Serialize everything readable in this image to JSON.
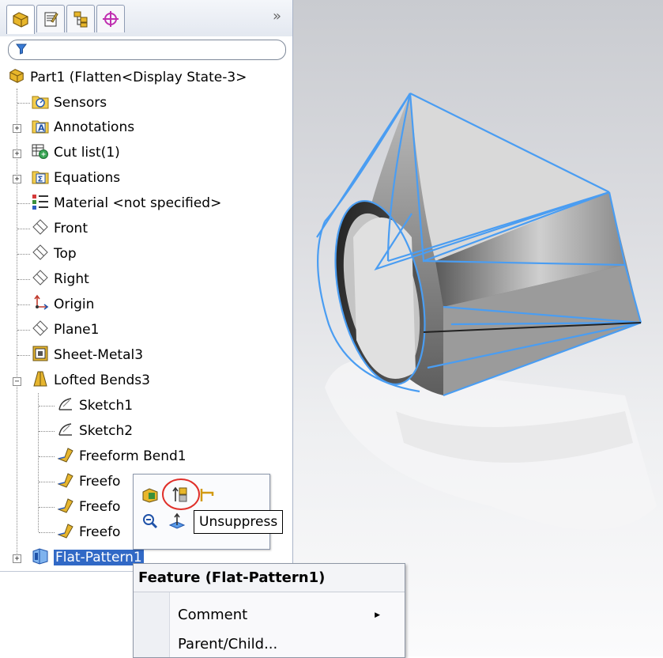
{
  "feature_tree": {
    "tabs": [
      "feature-manager-tab",
      "property-manager-tab",
      "configuration-manager-tab",
      "dim-xpert-tab"
    ],
    "more_label": "»",
    "filter_placeholder": "",
    "root_label": "Part1  (Flatten<Display State-3>",
    "items": [
      {
        "label": "Sensors",
        "icon": "sensors-folder-icon"
      },
      {
        "label": "Annotations",
        "icon": "annotations-folder-icon"
      },
      {
        "label": "Cut list(1)",
        "icon": "cut-list-icon"
      },
      {
        "label": "Equations",
        "icon": "equations-folder-icon"
      },
      {
        "label": "Material <not specified>",
        "icon": "material-icon"
      },
      {
        "label": "Front",
        "icon": "plane-icon"
      },
      {
        "label": "Top",
        "icon": "plane-icon"
      },
      {
        "label": "Right",
        "icon": "plane-icon"
      },
      {
        "label": "Origin",
        "icon": "origin-icon"
      },
      {
        "label": "Plane1",
        "icon": "plane-icon"
      },
      {
        "label": "Sheet-Metal3",
        "icon": "sheet-metal-icon"
      },
      {
        "label": "Lofted Bends3",
        "icon": "lofted-bends-icon"
      },
      {
        "label": "Sketch1",
        "icon": "sketch-icon"
      },
      {
        "label": "Sketch2",
        "icon": "sketch-icon"
      },
      {
        "label": "Freeform Bend1",
        "icon": "freeform-bend-icon"
      },
      {
        "label": "Freefo",
        "icon": "freeform-bend-icon"
      },
      {
        "label": "Freefo",
        "icon": "freeform-bend-icon"
      },
      {
        "label": "Freefo",
        "icon": "freeform-bend-icon"
      },
      {
        "label": "Flat-Pattern1",
        "icon": "flat-pattern-icon"
      }
    ]
  },
  "context_toolbar": {
    "tooltip": "Unsuppress"
  },
  "context_menu": {
    "title": "Feature (Flat-Pattern1)",
    "items": [
      {
        "label": "Comment",
        "submenu": true
      },
      {
        "label": "Parent/Child...",
        "submenu": false
      }
    ]
  },
  "colors": {
    "selection": "#3169c6",
    "edge_highlight": "#4a9df2",
    "highlight_circle": "#e0302a"
  }
}
